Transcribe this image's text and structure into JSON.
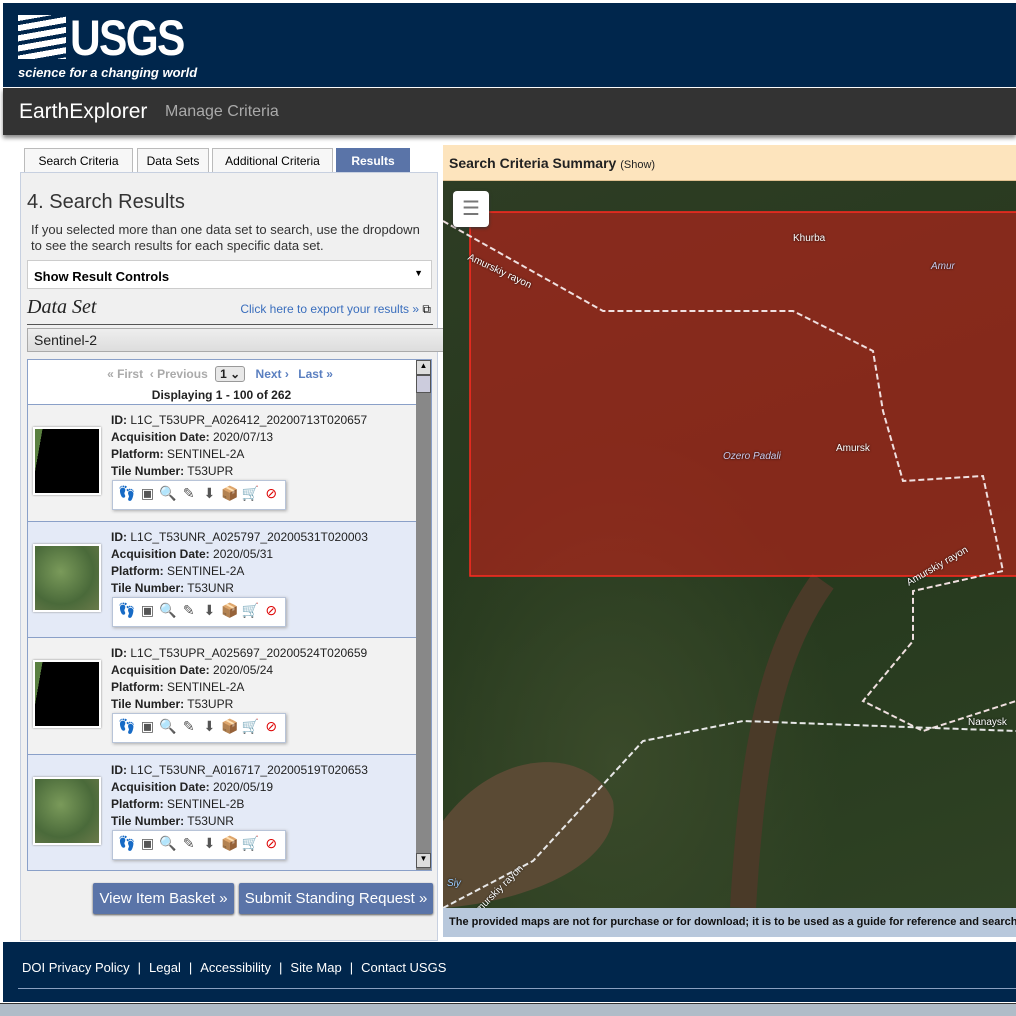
{
  "header": {
    "logo_text": "USGS",
    "logo_tagline": "science for a changing world"
  },
  "nav": {
    "title": "EarthExplorer",
    "manage": "Manage Criteria"
  },
  "tabs": [
    {
      "label": "Search Criteria"
    },
    {
      "label": "Data Sets"
    },
    {
      "label": "Additional Criteria"
    },
    {
      "label": "Results",
      "active": true
    }
  ],
  "panel": {
    "heading": "4. Search Results",
    "intro": "If you selected more than one data set to search, use the dropdown to see the search results for each specific data set.",
    "result_controls": "Show Result Controls",
    "dataset_label": "Data Set",
    "export_link": "Click here to export your results »",
    "dataset_selected": "Sentinel-2"
  },
  "pager": {
    "first": "« First",
    "previous": "‹ Previous",
    "page": "1",
    "next": "Next ›",
    "last": "Last »",
    "displaying": "Displaying 1 - 100 of 262"
  },
  "labels": {
    "id": "ID:",
    "date": "Acquisition Date:",
    "platform": "Platform:",
    "tile": "Tile Number:"
  },
  "results": [
    {
      "id": "L1C_T53UPR_A026412_20200713T020657",
      "date": "2020/07/13",
      "platform": "SENTINEL-2A",
      "tile": "T53UPR"
    },
    {
      "id": "L1C_T53UNR_A025797_20200531T020003",
      "date": "2020/05/31",
      "platform": "SENTINEL-2A",
      "tile": "T53UNR"
    },
    {
      "id": "L1C_T53UPR_A025697_20200524T020659",
      "date": "2020/05/24",
      "platform": "SENTINEL-2A",
      "tile": "T53UPR"
    },
    {
      "id": "L1C_T53UNR_A016717_20200519T020653",
      "date": "2020/05/19",
      "platform": "SENTINEL-2B",
      "tile": "T53UNR"
    }
  ],
  "result_icons": [
    "footprint-icon",
    "browse-overlay-icon",
    "compare-browse-icon",
    "metadata-icon",
    "download-icon",
    "bulk-download-icon",
    "cart-icon",
    "exclude-icon"
  ],
  "buttons": {
    "basket": "View Item Basket »",
    "standing": "Submit Standing Request »"
  },
  "map": {
    "summary_title": "Search Criteria Summary",
    "summary_show": "(Show)",
    "places": [
      "Khurba",
      "Amur",
      "Amurskiy rayon",
      "Amursk",
      "Ozero Padali",
      "Amurskiy rayon",
      "Nanaysk",
      "Siy",
      "Amurskiy rayon"
    ],
    "note": "The provided maps are not for purchase or for download; it is to be used as a guide for reference and search",
    "aoi_color": "#c0201a"
  },
  "footer": {
    "links": [
      "DOI Privacy Policy",
      "Legal",
      "Accessibility",
      "Site Map",
      "Contact USGS"
    ]
  }
}
